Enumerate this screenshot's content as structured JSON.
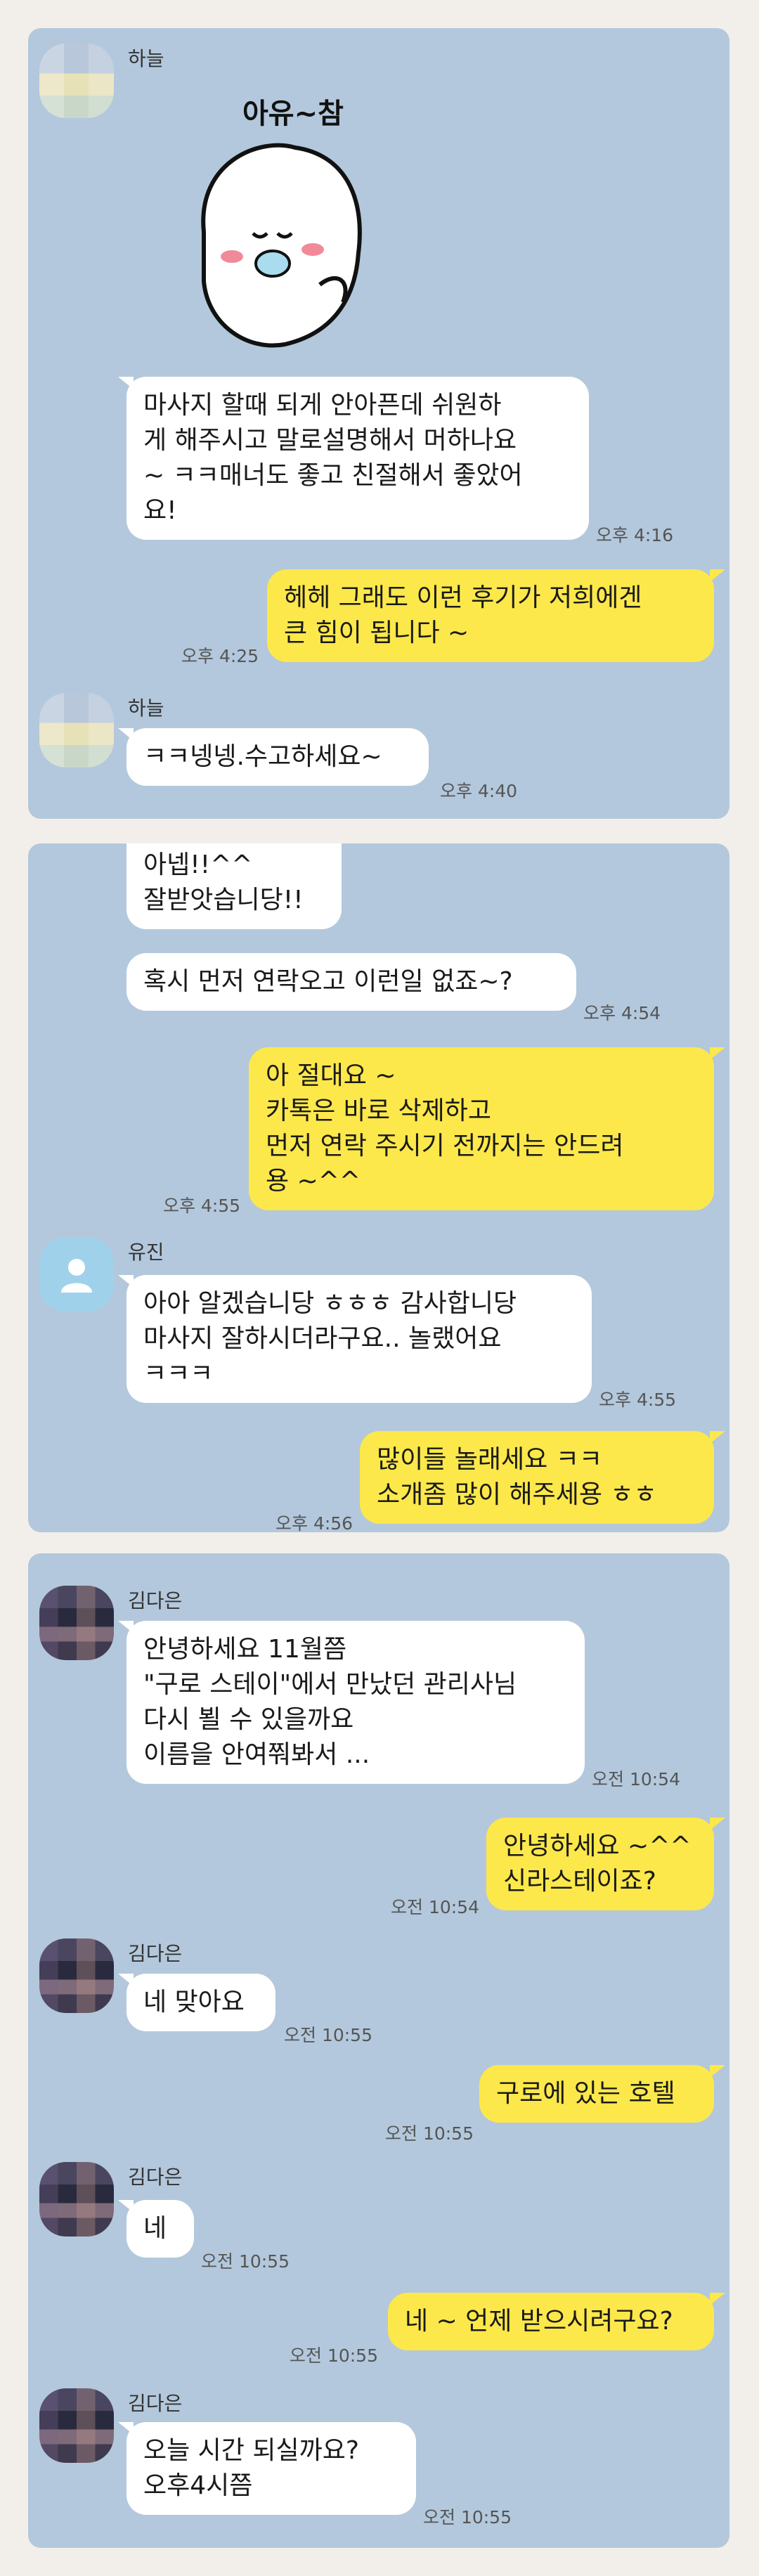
{
  "screen1": {
    "sender": "하늘",
    "sticker_text": "아유~참",
    "m1": "마사지 할때 되게 안아픈데 쉬원하\n게 해주시고 말로설명해서 머하나요\n~ ㅋㅋ매너도 좋고 친절해서 좋았어\n요!",
    "t1": "오후 4:16",
    "r1": "헤헤 그래도 이런 후기가 저희에겐\n큰 힘이 됩니다 ~",
    "rt1": "오후 4:25",
    "sender2": "하늘",
    "m2": "ㅋㅋ넹넹.수고하세요~",
    "t2": "오후 4:40"
  },
  "screen2": {
    "m0": "아넵!!^^\n잘받앗습니당!!",
    "m1": "혹시 먼저 연락오고 이런일 없죠~?",
    "t1": "오후 4:54",
    "r1": "아 절대요 ~\n카톡은 바로 삭제하고\n먼저 연락 주시기 전까지는 안드려\n용 ~^^",
    "rt1": "오후 4:55",
    "sender": "유진",
    "m2": "아아 알겠습니당 ㅎㅎㅎ 감사합니당\n마사지 잘하시더라구요.. 놀랬어요\nㅋㅋㅋ",
    "t2": "오후 4:55",
    "r2": "많이들 놀래세요 ㅋㅋ\n소개좀 많이 해주세용 ㅎㅎ",
    "rt2": "오후 4:56"
  },
  "screen3": {
    "sender": "김다은",
    "m1": "안녕하세요 11월쯤\n\"구로 스테이\"에서 만났던 관리사님\n다시 뵐 수 있을까요\n이름을 안여쭤봐서 ...",
    "t1": "오전 10:54",
    "r1": "안녕하세요 ~^^\n신라스테이죠?",
    "rt1": "오전 10:54",
    "sender2": "김다은",
    "m2": "네 맞아요",
    "t2": "오전 10:55",
    "r2": "구로에 있는 호텔",
    "rt2": "오전 10:55",
    "sender3": "김다은",
    "m3": "네",
    "t3": "오전 10:55",
    "r3": "네 ~ 언제 받으시려구요?",
    "rt3": "오전 10:55",
    "sender4": "김다은",
    "m4": "오늘  시간 되실까요?\n오후4시쯤",
    "t4": "오전 10:55"
  },
  "colors": {
    "chat_bg": "#b3c8dc",
    "my_bubble": "#fce84a",
    "their_bubble": "#ffffff",
    "page_bg": "#f2efeb"
  }
}
